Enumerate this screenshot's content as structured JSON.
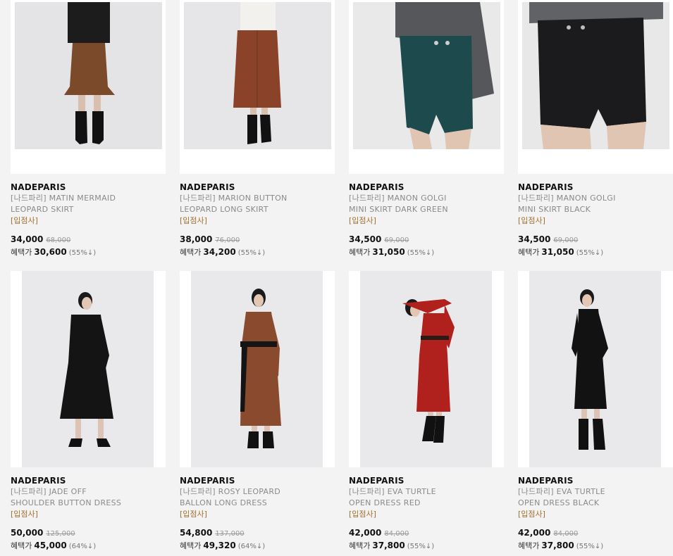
{
  "products": [
    {
      "brand": "NADEPARIS",
      "name_line1": "[나드파리] MATIN MERMAID",
      "name_line2": "LEOPARD SKIRT",
      "tag": "[입점사]",
      "price": "34,000",
      "original_price": "68,000",
      "benefit_label": "혜택가",
      "benefit_price": "30,600",
      "discount": "(55%↓)",
      "image": "woman in black top and brown leopard mermaid skirt with black boots",
      "colors": {
        "top": "#1c1c1c",
        "bottom": "#7a4a2a",
        "boots": "#111111"
      }
    },
    {
      "brand": "NADEPARIS",
      "name_line1": "[나드파리] MARION BUTTON",
      "name_line2": "LEOPARD LONG SKIRT",
      "tag": "[입점사]",
      "price": "38,000",
      "original_price": "76,000",
      "benefit_label": "혜택가",
      "benefit_price": "34,200",
      "discount": "(55%↓)",
      "image": "woman in white blouse and rust leopard button long skirt with black boots",
      "colors": {
        "top": "#f3f1ee",
        "bottom": "#8a4328",
        "boots": "#111111"
      }
    },
    {
      "brand": "NADEPARIS",
      "name_line1": "[나드파리] MANON GOLGI",
      "name_line2": "MINI SKIRT DARK GREEN",
      "tag": "[입점사]",
      "price": "34,500",
      "original_price": "69,000",
      "benefit_label": "혜택가",
      "benefit_price": "31,050",
      "discount": "(55%↓)",
      "image": "close-up of dark green corduroy mini skirt with grey sweater",
      "colors": {
        "top": "#55575b",
        "bottom": "#1d4b4d",
        "boots": "#111111"
      }
    },
    {
      "brand": "NADEPARIS",
      "name_line1": "[나드파리] MANON GOLGI",
      "name_line2": "MINI SKIRT BLACK",
      "tag": "[입점사]",
      "price": "34,500",
      "original_price": "69,000",
      "benefit_label": "혜택가",
      "benefit_price": "31,050",
      "discount": "(55%↓)",
      "image": "close-up of black corduroy mini skirt with grey sweater",
      "colors": {
        "top": "#606266",
        "bottom": "#1b1b1d",
        "boots": "#111111"
      }
    },
    {
      "brand": "NADEPARIS",
      "name_line1": "[나드파리] JADE OFF",
      "name_line2": "SHOULDER BUTTON DRESS",
      "tag": "[입점사]",
      "price": "50,000",
      "original_price": "125,000",
      "benefit_label": "혜택가",
      "benefit_price": "45,000",
      "discount": "(64%↓)",
      "image": "woman in black off-shoulder button dress with black boots",
      "colors": {
        "top": "#141414",
        "bottom": "#141414",
        "boots": "#111111"
      }
    },
    {
      "brand": "NADEPARIS",
      "name_line1": "[나드파리] ROSY LEOPARD",
      "name_line2": "BALLON LONG DRESS",
      "tag": "[입점사]",
      "price": "54,800",
      "original_price": "137,000",
      "benefit_label": "혜택가",
      "benefit_price": "49,320",
      "discount": "(64%↓)",
      "image": "woman in rust leopard balloon long dress with black belt and boots",
      "colors": {
        "top": "#8a4a2e",
        "bottom": "#8a4a2e",
        "boots": "#111111"
      }
    },
    {
      "brand": "NADEPARIS",
      "name_line1": "[나드파리] EVA TURTLE",
      "name_line2": "OPEN DRESS RED",
      "tag": "[입점사]",
      "price": "42,000",
      "original_price": "84,000",
      "benefit_label": "혜택가",
      "benefit_price": "37,800",
      "discount": "(55%↓)",
      "image": "woman in red turtleneck open dress with black belt and boots",
      "colors": {
        "top": "#b0201c",
        "bottom": "#b0201c",
        "boots": "#111111"
      }
    },
    {
      "brand": "NADEPARIS",
      "name_line1": "[나드파리] EVA TURTLE",
      "name_line2": "OPEN DRESS BLACK",
      "tag": "[입점사]",
      "price": "42,000",
      "original_price": "84,000",
      "benefit_label": "혜택가",
      "benefit_price": "37,800",
      "discount": "(55%↓)",
      "image": "woman in black turtleneck open dress with black boots",
      "colors": {
        "top": "#121212",
        "bottom": "#121212",
        "boots": "#111111"
      }
    }
  ]
}
